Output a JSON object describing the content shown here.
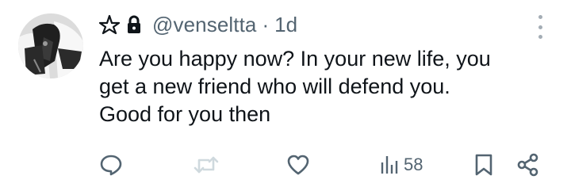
{
  "post": {
    "username": "@venseltta",
    "separator": "·",
    "time": "1d",
    "text_lines": [
      "Are you happy now? In your new life, you",
      "get a new friend who will defend you.",
      "Good for you then"
    ],
    "views": "58"
  },
  "icons": {
    "header": [
      "pentagram-icon",
      "lock-icon"
    ],
    "menu": "more-vertical-icon",
    "actions": [
      "reply-icon",
      "repost-icon",
      "like-icon",
      "views-icon",
      "bookmark-icon",
      "share-icon"
    ]
  },
  "colors": {
    "text_primary": "#0f1419",
    "text_secondary": "#536471",
    "repost_disabled": "#cfd9de"
  }
}
